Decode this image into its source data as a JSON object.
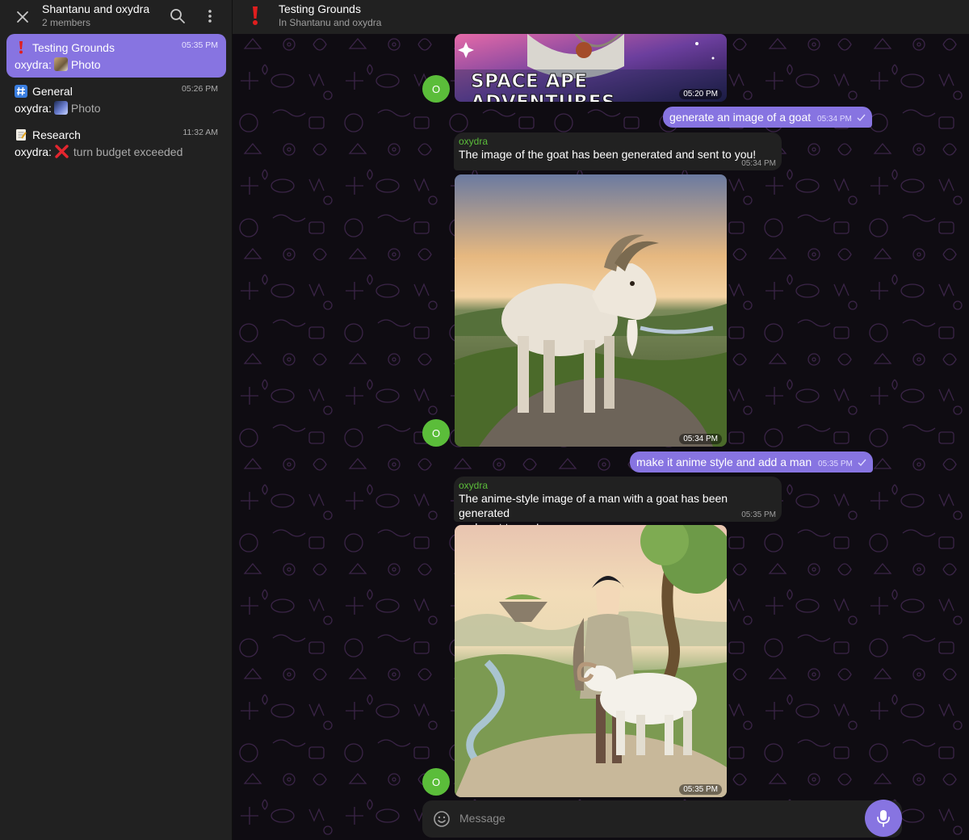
{
  "sidebar": {
    "title": "Shantanu and oxydra",
    "subtitle": "2 members",
    "chats": [
      {
        "name": "Testing Grounds",
        "icon": "exclamation-icon",
        "time": "05:35 PM",
        "sender": "oxydra:",
        "preview": "Photo",
        "active": true
      },
      {
        "name": "General",
        "icon": "hash-icon",
        "time": "05:26 PM",
        "sender": "oxydra:",
        "preview": "Photo",
        "active": false
      },
      {
        "name": "Research",
        "icon": "memo-icon",
        "time": "11:32 AM",
        "sender": "oxydra:",
        "preview": "turn budget exceeded",
        "active": false
      }
    ]
  },
  "header": {
    "title": "Testing Grounds",
    "subtitle": "In Shantanu and oxydra"
  },
  "messages": {
    "avatar_letter": "O",
    "img1": {
      "caption": "SPACE APE ADVENTURES",
      "time": "05:20 PM"
    },
    "out1": {
      "text": "generate an image of a goat",
      "time": "05:34 PM"
    },
    "in1": {
      "sender": "oxydra",
      "text": "The image of the goat has been generated and sent to you!",
      "time": "05:34 PM"
    },
    "img2": {
      "time": "05:34 PM"
    },
    "out2": {
      "text": "make it anime style and add a man",
      "time": "05:35 PM"
    },
    "in2": {
      "sender": "oxydra",
      "text1": "The anime-style image of a man with a goat has been generated",
      "text2": "and sent to you!",
      "time": "05:35 PM"
    },
    "img3": {
      "time": "05:35 PM"
    }
  },
  "composer": {
    "placeholder": "Message"
  },
  "colors": {
    "accent": "#8774e1",
    "sender": "#5bbd3a",
    "panel": "#212121"
  }
}
